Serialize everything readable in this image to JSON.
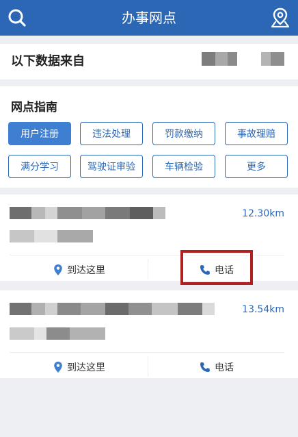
{
  "header": {
    "title": "办事网点",
    "search_icon": "search-icon",
    "location_icon": "location-pin-icon",
    "color": "#2b67b5"
  },
  "source": {
    "label": "以下数据来自"
  },
  "guide": {
    "title": "网点指南",
    "buttons": [
      "用户注册",
      "违法处理",
      "罚款缴纳",
      "事故理赔",
      "满分学习",
      "驾驶证审验",
      "车辆检验",
      "更多"
    ],
    "active_index": 0
  },
  "locations": [
    {
      "distance": "12.30km",
      "navigate_label": "到达这里",
      "phone_label": "电话"
    },
    {
      "distance": "13.54km",
      "navigate_label": "到达这里",
      "phone_label": "电话"
    }
  ],
  "accent_color": "#3f7fd1",
  "highlight_color": "#b0201f"
}
